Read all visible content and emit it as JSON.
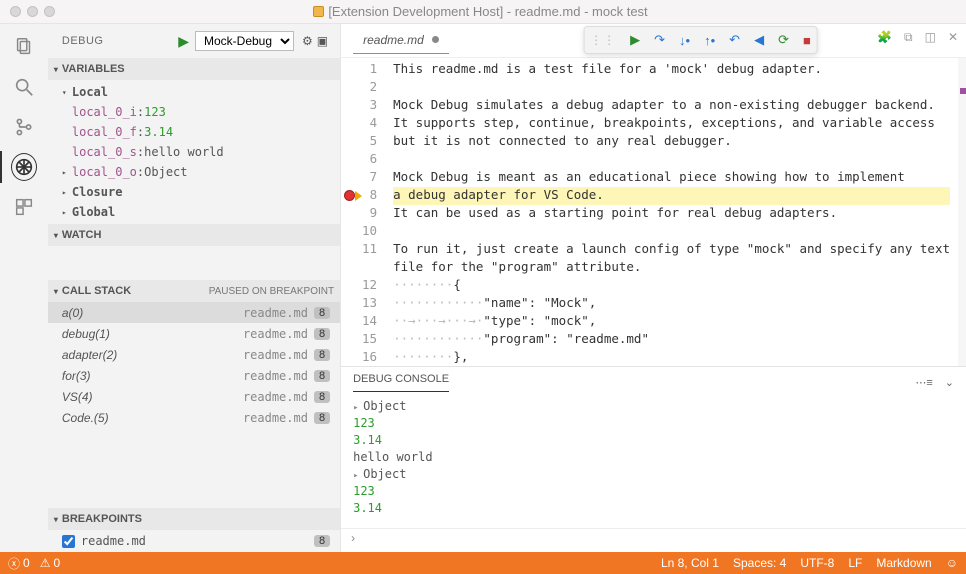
{
  "window": {
    "title": "[Extension Development Host] - readme.md - mock test"
  },
  "sidebar": {
    "header": {
      "label": "DEBUG",
      "config": "Mock-Debug"
    },
    "sections": {
      "variables": "Variables",
      "watch": "Watch",
      "callstack": "Call Stack",
      "callstack_status": "PAUSED ON BREAKPOINT",
      "breakpoints": "Breakpoints"
    },
    "scopes": {
      "local": "Local",
      "closure": "Closure",
      "global": "Global"
    },
    "locals": [
      {
        "name": "local_0_i",
        "value": "123",
        "kind": "num"
      },
      {
        "name": "local_0_f",
        "value": "3.14",
        "kind": "num"
      },
      {
        "name": "local_0_s",
        "value": "hello world",
        "kind": "str"
      },
      {
        "name": "local_0_o",
        "value": "Object",
        "kind": "obj",
        "expandable": true
      }
    ]
  },
  "callstack": [
    {
      "fn": "a(0)",
      "loc": "readme.md",
      "line": "8",
      "selected": true
    },
    {
      "fn": "debug(1)",
      "loc": "readme.md",
      "line": "8"
    },
    {
      "fn": "adapter(2)",
      "loc": "readme.md",
      "line": "8"
    },
    {
      "fn": "for(3)",
      "loc": "readme.md",
      "line": "8"
    },
    {
      "fn": "VS(4)",
      "loc": "readme.md",
      "line": "8"
    },
    {
      "fn": "Code.(5)",
      "loc": "readme.md",
      "line": "8"
    }
  ],
  "breakpoints": [
    {
      "enabled": true,
      "file": "readme.md",
      "line": "8"
    }
  ],
  "editor": {
    "tab": "readme.md",
    "lines": [
      "This readme.md is a test file for a 'mock' debug adapter.",
      "",
      "Mock Debug simulates a debug adapter to a non-existing debugger backend.",
      "It supports step, continue, breakpoints, exceptions, and variable access",
      "but it is not connected to any real debugger.",
      "",
      "Mock Debug is meant as an educational piece showing how to implement",
      "a debug adapter for VS Code.",
      "It can be used as a starting point for real debug adapters.",
      "",
      "To run it, just create a launch config of type \"mock\" and specify any text",
      "file for the \"program\" attribute.",
      "········{",
      "············\"name\": \"Mock\",",
      "··→···→···→·\"type\": \"mock\",",
      "············\"program\": \"readme.md\"",
      "········},"
    ],
    "line_numbers": [
      "1",
      "2",
      "3",
      "4",
      "5",
      "6",
      "7",
      "8",
      "9",
      "10",
      "11",
      "",
      "12",
      "13",
      "14",
      "15",
      "16"
    ],
    "current_line_index": 7
  },
  "panel": {
    "title": "DEBUG CONSOLE",
    "entries": [
      {
        "t": "obj",
        "v": "Object"
      },
      {
        "t": "num",
        "v": "123"
      },
      {
        "t": "num",
        "v": "3.14"
      },
      {
        "t": "str",
        "v": "hello world"
      },
      {
        "t": "obj",
        "v": "Object"
      },
      {
        "t": "num",
        "v": "123"
      },
      {
        "t": "num",
        "v": "3.14"
      }
    ],
    "prompt": "›"
  },
  "status": {
    "errors": "0",
    "warnings": "0",
    "lncol": "Ln 8, Col 1",
    "spaces": "Spaces: 4",
    "enc": "UTF-8",
    "eol": "LF",
    "lang": "Markdown"
  },
  "colors": {
    "accent": "#f07623",
    "play": "#2e8b2e",
    "stop": "#c43b3b",
    "step": "#2876d3"
  }
}
